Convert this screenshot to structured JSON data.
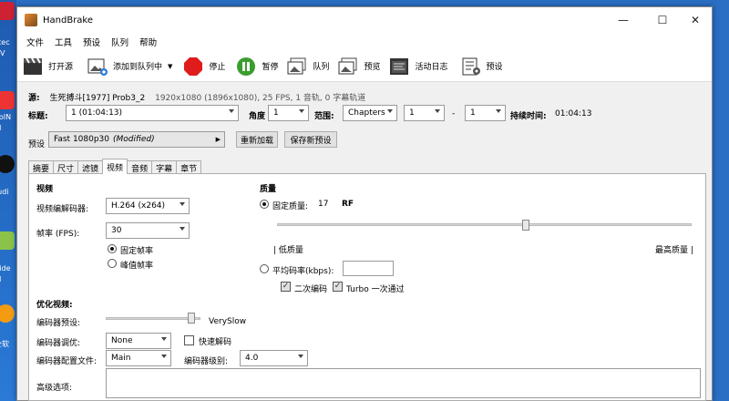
{
  "desktop": {
    "fragments": [
      "stec",
      "DV",
      "ooIN",
      "ul",
      "tudi",
      "Vide",
      "ul",
      "全软"
    ]
  },
  "window": {
    "title": "HandBrake",
    "controls": [
      "—",
      "☐",
      "✕"
    ]
  },
  "menu": [
    "文件",
    "工具",
    "预设",
    "队列",
    "帮助"
  ],
  "toolbar": {
    "open_source": "打开源",
    "add_to_queue": "添加到队列中",
    "stop": "停止",
    "pause": "暂停",
    "queue": "队列",
    "preview": "预览",
    "activity_log": "活动日志",
    "presets": "预设"
  },
  "source": {
    "label": "源:",
    "name": "生死搏斗[1977] Prob3_2",
    "info": "1920x1080 (1896x1080), 25 FPS, 1 音轨, 0 字幕轨道"
  },
  "title_row": {
    "title_label": "标题:",
    "title_value": "1 (01:04:13)",
    "angle_label": "角度",
    "angle_value": "1",
    "range_label": "范围:",
    "range_type": "Chapters",
    "range_start": "1",
    "range_sep": "-",
    "range_end": "1",
    "duration_label": "持续时间:",
    "duration_value": "01:04:13"
  },
  "preset_row": {
    "label": "预设",
    "value": "Fast 1080p30",
    "modified": "(Modified)",
    "arrow": "▶",
    "reload": "重新加载",
    "save_new": "保存新预设"
  },
  "tabs": [
    "摘要",
    "尺寸",
    "滤镜",
    "视频",
    "音频",
    "字幕",
    "章节"
  ],
  "active_tab": "视频",
  "video": {
    "section": "视频",
    "encoder_label": "视频编解码器:",
    "encoder_value": "H.264 (x264)",
    "fps_label": "帧率 (FPS):",
    "fps_value": "30",
    "constant_fr": "固定帧率",
    "peak_fr": "峰值帧率"
  },
  "quality": {
    "section": "质量",
    "cq_label": "固定质量:",
    "cq_value": "17",
    "cq_unit": "RF",
    "cq_slider_fraction": 0.6,
    "low": "| 低质量",
    "high": "最高质量 |",
    "abr_label": "平均码率(kbps):",
    "abr_value": "",
    "two_pass": "二次编码",
    "turbo": "Turbo 一次通过"
  },
  "optimise": {
    "section": "优化视频:",
    "preset_label": "编码器预设:",
    "preset_value": "VerySlow",
    "preset_slider_fraction": 0.9,
    "tune_label": "编码器调优:",
    "tune_value": "None",
    "fast_decode": "快速解码",
    "profile_label": "编码器配置文件:",
    "profile_value": "Main",
    "level_label": "编码器级别:",
    "level_value": "4.0",
    "advanced_label": "高级选项:",
    "advanced_value": ""
  }
}
